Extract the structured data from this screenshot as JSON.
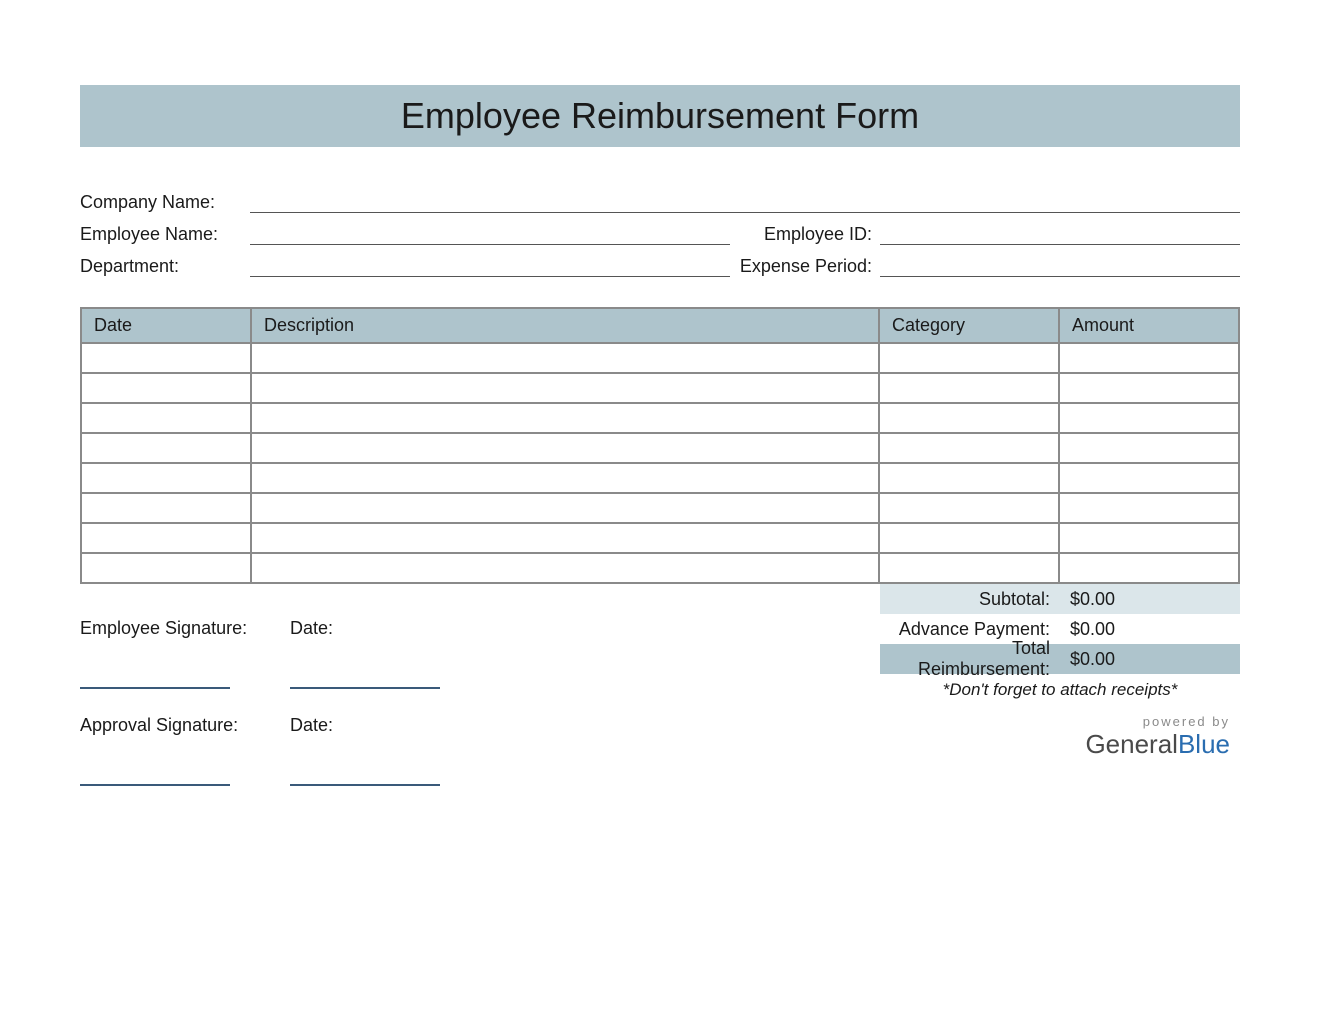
{
  "title": "Employee Reimbursement Form",
  "labels": {
    "company_name": "Company Name:",
    "employee_name": "Employee Name:",
    "employee_id": "Employee ID:",
    "department": "Department:",
    "expense_period": "Expense Period:",
    "employee_signature": "Employee Signature:",
    "approval_signature": "Approval Signature:",
    "date": "Date:"
  },
  "table": {
    "headers": {
      "date": "Date",
      "description": "Description",
      "category": "Category",
      "amount": "Amount"
    },
    "row_count": 8
  },
  "totals": {
    "subtotal_label": "Subtotal:",
    "subtotal_value": "$0.00",
    "advance_label": "Advance Payment:",
    "advance_value": "$0.00",
    "total_label": "Total Reimbursement:",
    "total_value": "$0.00"
  },
  "reminder": "*Don't forget to attach receipts*",
  "brand": {
    "powered_by": "powered by",
    "name_a": "General",
    "name_b": "Blue"
  }
}
